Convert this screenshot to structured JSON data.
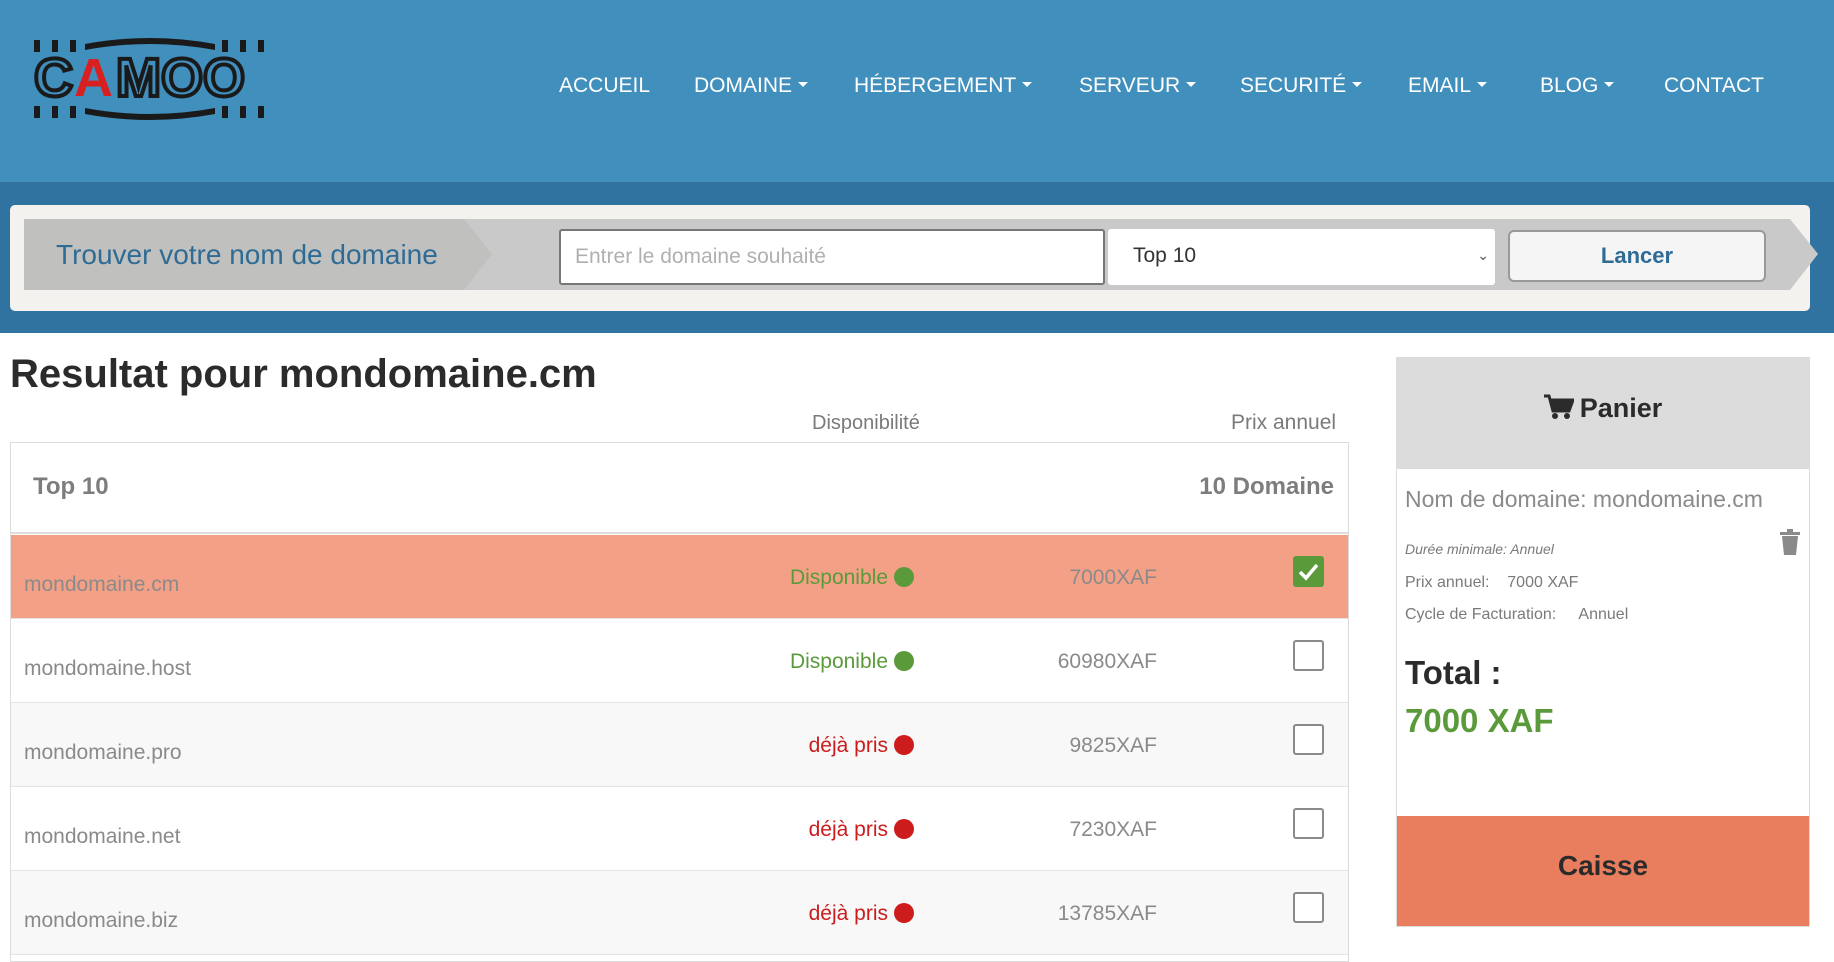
{
  "brand": {
    "logo_text": "CAMOO"
  },
  "nav": {
    "items": [
      {
        "label": "ACCUEIL"
      },
      {
        "label": "DOMAINE"
      },
      {
        "label": "HÉBERGEMENT"
      },
      {
        "label": "SERVEUR"
      },
      {
        "label": "SECURITÉ"
      },
      {
        "label": "EMAIL"
      },
      {
        "label": "BLOG"
      },
      {
        "label": "CONTACT"
      }
    ]
  },
  "search": {
    "label": "Trouver votre nom de domaine",
    "placeholder": "Entrer le domaine souhaité",
    "select_value": "Top 10",
    "button": "Lancer"
  },
  "results": {
    "title": "Resultat pour mondomaine.cm",
    "col_availability": "Disponibilité",
    "col_price": "Prix annuel",
    "group_label": "Top 10",
    "group_count": "10 Domaine",
    "rows": [
      {
        "name": "mondomaine.cm",
        "status": "Disponible",
        "available": true,
        "price": "7000XAF",
        "checked": true
      },
      {
        "name": "mondomaine.host",
        "status": "Disponible",
        "available": true,
        "price": "60980XAF",
        "checked": false
      },
      {
        "name": "mondomaine.pro",
        "status": "déjà pris",
        "available": false,
        "price": "9825XAF",
        "checked": false
      },
      {
        "name": "mondomaine.net",
        "status": "déjà pris",
        "available": false,
        "price": "7230XAF",
        "checked": false
      },
      {
        "name": "mondomaine.biz",
        "status": "déjà pris",
        "available": false,
        "price": "13785XAF",
        "checked": false
      }
    ]
  },
  "cart": {
    "title": "Panier",
    "domain_line": "Nom de domaine: mondomaine.cm",
    "min_duration": "Durée minimale: Annuel",
    "price_label": "Prix annuel:",
    "price_value": "7000 XAF",
    "cycle_label": "Cycle de Facturation:",
    "cycle_value": "Annuel",
    "total_label": "Total :",
    "total_value": "7000 XAF",
    "checkout": "Caisse"
  },
  "colors": {
    "header": "#418fbd",
    "band": "#3073a0",
    "selected_row": "#f4a086",
    "available": "#5a9a3a",
    "taken": "#cc1c1c",
    "checkout": "#e87e5e"
  }
}
